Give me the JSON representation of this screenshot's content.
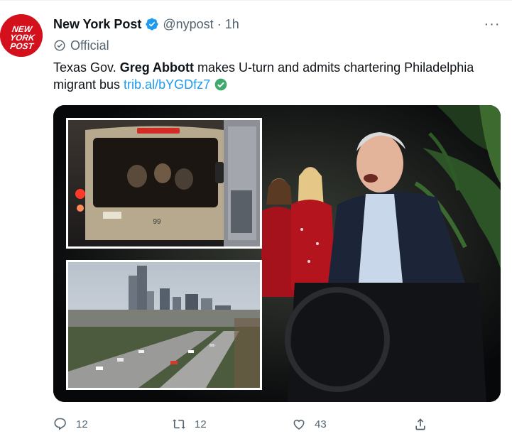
{
  "tweet": {
    "author_name": "New York Post",
    "handle": "@nypost",
    "separator": "·",
    "time": "1h",
    "official_label": "Official",
    "avatar_text_lines": [
      "NEW",
      "YORK",
      "POST"
    ],
    "text_prefix": "Texas Gov. ",
    "text_bold": "Greg Abbott",
    "text_suffix": " makes U-turn and admits chartering Philadelphia migrant bus ",
    "link": "trib.al/bYGDfz7",
    "more_label": "···",
    "bus_number": "99",
    "icons": {
      "verified": "verified-badge-icon",
      "official": "official-shield-icon",
      "link_check": "green-check-icon",
      "reply": "reply-icon",
      "retweet": "retweet-icon",
      "like": "heart-icon",
      "share": "share-icon"
    }
  },
  "actions": {
    "reply_count": "12",
    "retweet_count": "12",
    "like_count": "43"
  },
  "colors": {
    "brand_red": "#d4101d",
    "link_blue": "#1d9bf0",
    "verified_blue": "#1d9bf0",
    "green_check": "#3fa86b",
    "muted": "#536471"
  }
}
